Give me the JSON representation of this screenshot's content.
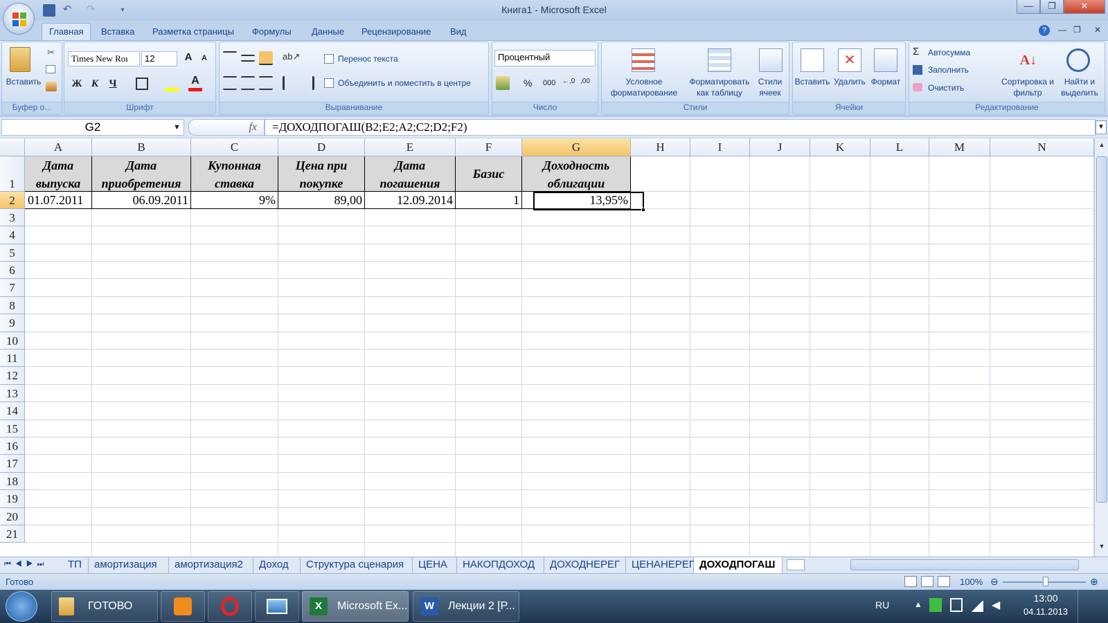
{
  "window": {
    "title": "Книга1 - Microsoft Excel",
    "minimize": "—",
    "maximize": "❐",
    "close": "✕"
  },
  "ribbon_tabs": [
    "Главная",
    "Вставка",
    "Разметка страницы",
    "Формулы",
    "Данные",
    "Рецензирование",
    "Вид"
  ],
  "clipboard": {
    "paste_label": "Вставить",
    "group_label": "Буфер о..."
  },
  "font": {
    "name": "Times New Roı",
    "size": "12",
    "bold": "Ж",
    "italic": "К",
    "underline": "Ч",
    "grow": "A",
    "shrink": "A",
    "font_color": "A",
    "group_label": "Шрифт"
  },
  "alignment": {
    "wrap_text": "Перенос текста",
    "merge_center": "Объединить и поместить в центре",
    "group_label": "Выравнивание"
  },
  "number": {
    "format": "Процентный",
    "percent": "%",
    "thousands": "000",
    "inc_decimal": "←,0",
    "dec_decimal": ",00",
    "group_label": "Число"
  },
  "styles": {
    "conditional": "Условное форматирование",
    "format_table": "Форматировать как таблицу",
    "cell_styles": "Стили ячеек",
    "group_label": "Стили"
  },
  "cells": {
    "insert": "Вставить",
    "delete": "Удалить",
    "format": "Формат",
    "group_label": "Ячейки"
  },
  "editing": {
    "autosum": "Автосумма",
    "fill": "Заполнить",
    "clear": "Очистить",
    "sort_filter": "Сортировка и фильтр",
    "find_select": "Найти и выделить",
    "group_label": "Редактирование"
  },
  "formula_bar": {
    "name_box": "G2",
    "fx": "fx",
    "formula": "=ДОХОДПОГАШ(B2;E2;A2;C2;D2;F2)"
  },
  "columns": [
    "A",
    "B",
    "C",
    "D",
    "E",
    "F",
    "G",
    "H",
    "I",
    "J",
    "K",
    "L",
    "M",
    "N"
  ],
  "rows": [
    "1",
    "2",
    "3",
    "4",
    "5",
    "6",
    "7",
    "8",
    "9",
    "10",
    "11",
    "12",
    "13",
    "14",
    "15",
    "16",
    "17",
    "18",
    "19",
    "20",
    "21"
  ],
  "header_row": [
    "Дата выпуска",
    "Дата приобретения",
    "Купонная ставка",
    "Цена при покупке",
    "Дата погашения",
    "Базис",
    "Доходность облигации"
  ],
  "data_row": [
    "01.07.2011",
    "06.09.2011",
    "9%",
    "89,00",
    "12.09.2014",
    "1",
    "13,95%"
  ],
  "sheet_tabs": [
    "ТП",
    "амортизация",
    "амортизация2",
    "Доход",
    "Структура сценария",
    "ЦЕНА",
    "НАКОПДОХОД",
    "ДОХОДНЕРЕГ",
    "ЦЕНАНЕРЕГ",
    "ДОХОДПОГАШ"
  ],
  "active_sheet": "ДОХОДПОГАШ",
  "status": {
    "ready": "Готово",
    "zoom": "100%"
  },
  "taskbar": {
    "items": [
      "ГОТОВО",
      "Microsoft Ex...",
      "Лекции 2 [Р..."
    ],
    "lang": "RU",
    "time": "13:00",
    "date": "04.11.2013"
  },
  "colors": {
    "accent": "#15428b",
    "selected_header": "#f5c36b",
    "header_fill": "#d9d9d9"
  }
}
